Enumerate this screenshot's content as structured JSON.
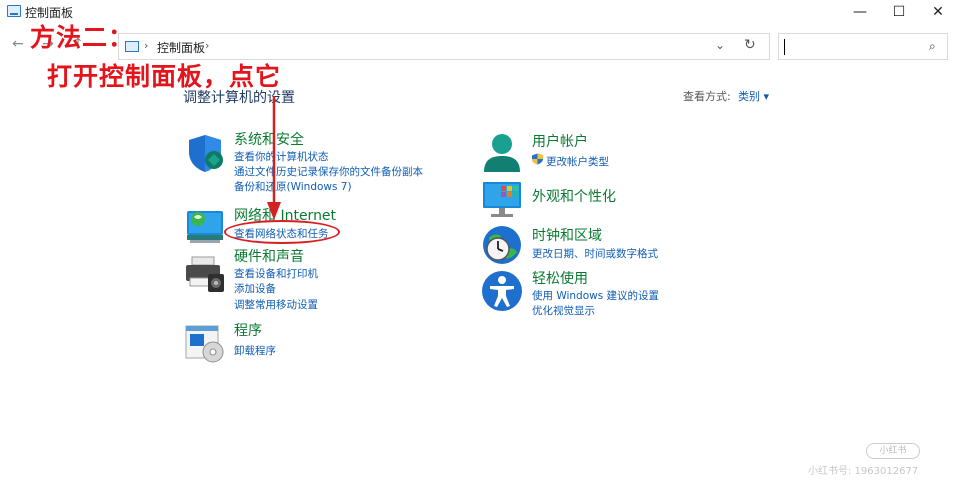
{
  "window": {
    "title": "控制面板",
    "minimize": "—",
    "maximize": "☐",
    "close": "✕"
  },
  "nav": {
    "back": "←",
    "forward": "→",
    "up": "↑"
  },
  "address": {
    "sep1": "›",
    "path": "控制面板",
    "sep2": "›",
    "dropdown": "⌄",
    "refresh": "↻"
  },
  "search": {
    "placeholder": "",
    "icon": "⌕"
  },
  "annotation": {
    "line1": "方法二：",
    "line2": "打开控制面板，点它"
  },
  "heading": "调整计算机的设置",
  "view_by": {
    "label": "查看方式:",
    "value": "类别 ▾"
  },
  "categories_left": [
    {
      "title": "系统和安全",
      "icon": "shield-icon",
      "links": [
        "查看你的计算机状态",
        "通过文件历史记录保存你的文件备份副本",
        "备份和还原(Windows 7)"
      ]
    },
    {
      "title": "网络和 Internet",
      "icon": "network-icon",
      "links": [
        "查看网络状态和任务"
      ]
    },
    {
      "title": "硬件和声音",
      "icon": "printer-icon",
      "links": [
        "查看设备和打印机",
        "添加设备",
        "调整常用移动设置"
      ]
    },
    {
      "title": "程序",
      "icon": "programs-icon",
      "links": [
        "卸载程序"
      ]
    }
  ],
  "categories_right": [
    {
      "title": "用户帐户",
      "icon": "user-icon",
      "links": [
        "更改帐户类型"
      ]
    },
    {
      "title": "外观和个性化",
      "icon": "monitor-icon",
      "links": []
    },
    {
      "title": "时钟和区域",
      "icon": "clock-globe-icon",
      "links": [
        "更改日期、时间或数字格式"
      ]
    },
    {
      "title": "轻松使用",
      "icon": "accessibility-icon",
      "links": [
        "使用 Windows 建议的设置",
        "优化视觉显示"
      ]
    }
  ],
  "watermark": {
    "badge": "小红书",
    "text": "小红书号: 1963012677"
  },
  "colors": {
    "accent_red": "#e3141b",
    "link_blue": "#0f5db5",
    "title_green": "#0a7a31"
  }
}
